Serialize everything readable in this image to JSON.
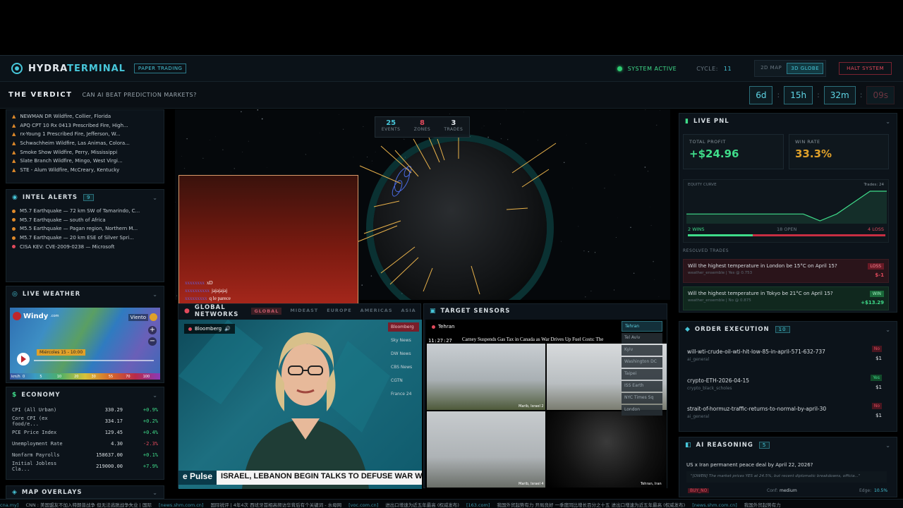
{
  "header": {
    "brand_a": "HYDRA",
    "brand_b": "TERMINAL",
    "mode_badge": "PAPER TRADING",
    "status": "SYSTEM ACTIVE",
    "cycle_label": "CYCLE:",
    "cycle_value": "11",
    "view_2d": "2D MAP",
    "view_3d": "3D GLOBE",
    "halt": "HALT SYSTEM"
  },
  "verdict": {
    "title": "THE VERDICT",
    "subtitle": "CAN AI BEAT PREDICTION MARKETS?",
    "days": "6d",
    "hours": "15h",
    "minutes": "32m",
    "seconds": "09s"
  },
  "wildfires": {
    "items": [
      "NEWMAN DR Wildfire, Collier, Florida",
      "APQ CPT 10 Rx 0413 Prescribed Fire, High...",
      "rx-Young 1 Prescribed Fire, Jefferson, W...",
      "Schwachheim Wildfire, Las Animas, Colora...",
      "Smoke Show Wildfire, Perry, Mississippi",
      "Slate Branch Wildfire, Mingo, West Virgi...",
      "STE - Alum Wildfire, McCreary, Kentucky"
    ]
  },
  "intel": {
    "title": "INTEL ALERTS",
    "count": "9",
    "items": [
      {
        "text": "M5.7 Earthquake — 72 km SW of Tamarindo, C...",
        "color": "#e08a2a"
      },
      {
        "text": "M5.7 Earthquake — south of Africa",
        "color": "#e08a2a"
      },
      {
        "text": "M5.5 Earthquake — Pagan region, Northern M...",
        "color": "#e08a2a"
      },
      {
        "text": "M5.7 Earthquake — 20 km ESE of Silver Spri...",
        "color": "#e08a2a"
      },
      {
        "text": "CISA KEV: CVE-2009-0238 — Microsoft",
        "color": "#e24a5c"
      }
    ]
  },
  "weather": {
    "title": "LIVE WEATHER",
    "provider": "Windy",
    "provider_suffix": ".com",
    "layer": "Viento",
    "date_label": "Miércoles 15 - 10:00",
    "unit": "km/h",
    "scale": [
      "0",
      "5",
      "10",
      "20",
      "30",
      "55",
      "70",
      "100"
    ]
  },
  "economy": {
    "title": "ECONOMY",
    "rows": [
      {
        "name": "CPI (All Urban)",
        "value": "330.29",
        "change": "+0.9%"
      },
      {
        "name": "Core CPI (ex food/e...",
        "value": "334.17",
        "change": "+0.2%"
      },
      {
        "name": "PCE Price Index",
        "value": "129.45",
        "change": "+0.4%"
      },
      {
        "name": "Unemployment Rate",
        "value": "4.30",
        "change": "-2.3%"
      },
      {
        "name": "Nonfarm Payrolls",
        "value": "158637.00",
        "change": "+0.1%"
      },
      {
        "name": "Initial Jobless Cla...",
        "value": "219000.00",
        "change": "+7.9%"
      }
    ]
  },
  "map_overlays": {
    "title": "MAP OVERLAYS"
  },
  "globe": {
    "events": "25",
    "events_label": "EVENTS",
    "zones": "8",
    "zones_label": "ZONES",
    "trades": "3",
    "trades_label": "TRADES"
  },
  "stream_chat": [
    {
      "user": "xxxxxxxx",
      "msg": "xD"
    },
    {
      "user": "xxxxxxxxxx",
      "msg": "jajajajaj"
    },
    {
      "user": "xxxxxxxxx",
      "msg": "q le parece"
    }
  ],
  "networks": {
    "title": "GLOBAL NETWORKS",
    "tabs": [
      "GLOBAL",
      "MIDEAST",
      "EUROPE",
      "AMERICAS",
      "ASIA"
    ],
    "active_channel": "Bloomberg",
    "channels": [
      "Bloomberg",
      "Sky News",
      "DW News",
      "CBS News",
      "CGTN",
      "France 24"
    ],
    "ticker_brand": "e Pulse",
    "headline": "ISRAEL, LEBANON BEGIN TALKS TO DEFUSE WAR WITH HEZBOLLAH"
  },
  "sensors": {
    "title": "TARGET SENSORS",
    "location": "Tehran",
    "time": "11:27:27",
    "news_line": "Carney Suspends Gas Tax in Canada as War Drives Up Fuel Costs: The",
    "cities": [
      "Tehran",
      "Tel Aviv",
      "Kyiv",
      "Washington DC",
      "Taipei",
      "ISS Earth",
      "NYC Times Sq",
      "London"
    ],
    "cam_labels": [
      "Marib, Israel  2",
      "Marib, Israel  4",
      "Tehran, Iran"
    ]
  },
  "pnl": {
    "title": "LIVE PNL",
    "total_profit_label": "TOTAL PROFIT",
    "total_profit": "+$24.96",
    "win_rate_label": "WIN RATE",
    "win_rate": "33.3%",
    "equity_label": "EQUITY CURVE",
    "trades_label": "Trades: 24",
    "wins": "2 WINS",
    "open": "18 OPEN",
    "losses": "4 LOSS",
    "win_fraction": 0.33,
    "equity_series": [
      0,
      0,
      0,
      0,
      0,
      0,
      0,
      0,
      -0.3,
      0,
      0.5,
      1,
      1
    ]
  },
  "resolved": {
    "title": "RESOLVED TRADES",
    "trades": [
      {
        "q": "Will the highest temperature in London be 15°C on April 15?",
        "meta": "weather_ensemble | Yes @ 0.753",
        "tag": "LOSS",
        "amt": "$-1"
      },
      {
        "q": "Will the highest temperature in Tokyo be 21°C on April 15?",
        "meta": "weather_ensemble | No @ 0.875",
        "tag": "WIN",
        "amt": "+$13.29"
      }
    ]
  },
  "orders": {
    "title": "ORDER EXECUTION",
    "count": "10",
    "items": [
      {
        "title": "will-wti-crude-oil-wti-hit-low-85-in-april-571-632-737",
        "src": "ai_general",
        "side": "No",
        "amt": "$1"
      },
      {
        "title": "crypto-ETH-2026-04-15",
        "src": "crypto_black_scholes",
        "side": "Yes",
        "amt": "$1"
      },
      {
        "title": "strait-of-hormuz-traffic-returns-to-normal-by-april-30",
        "src": "ai_general",
        "side": "No",
        "amt": "$1"
      }
    ]
  },
  "reasoning": {
    "title": "AI REASONING",
    "count": "5",
    "question": "US x Iran permanent peace deal by April 22, 2026?",
    "quote": "\"[OWEN] The market prices YES at 24.5%, but recent diplomatic breakdowns, officia...\"",
    "action": "BUY_NO",
    "conf_label": "Conf:",
    "conf": "medium",
    "edge_label": "Edge:",
    "edge": "10.5%"
  },
  "newsbar": [
    {
      "src": "cna.my]",
      "text": "CNN : 美国盟友不加入特朗普战争 但无法逃脱战争失业 | 国际"
    },
    {
      "src": "[news.shm.com.cn]",
      "text": "国际锐评 | 4年4次 西班牙首相高频访华背后有个关键词 - 水母网"
    },
    {
      "src": "[voc.com.cn]",
      "text": "进出口增速为近五年最高 (权威发布)"
    },
    {
      "src": "[163.com]",
      "text": "我国外贸起势有力 开局良好 一季度同比增长百分之十五 进出口增速为近五年最高 (权威发布)"
    },
    {
      "src": "[news.shm.com.cn]",
      "text": "我国外贸起势有力"
    }
  ]
}
